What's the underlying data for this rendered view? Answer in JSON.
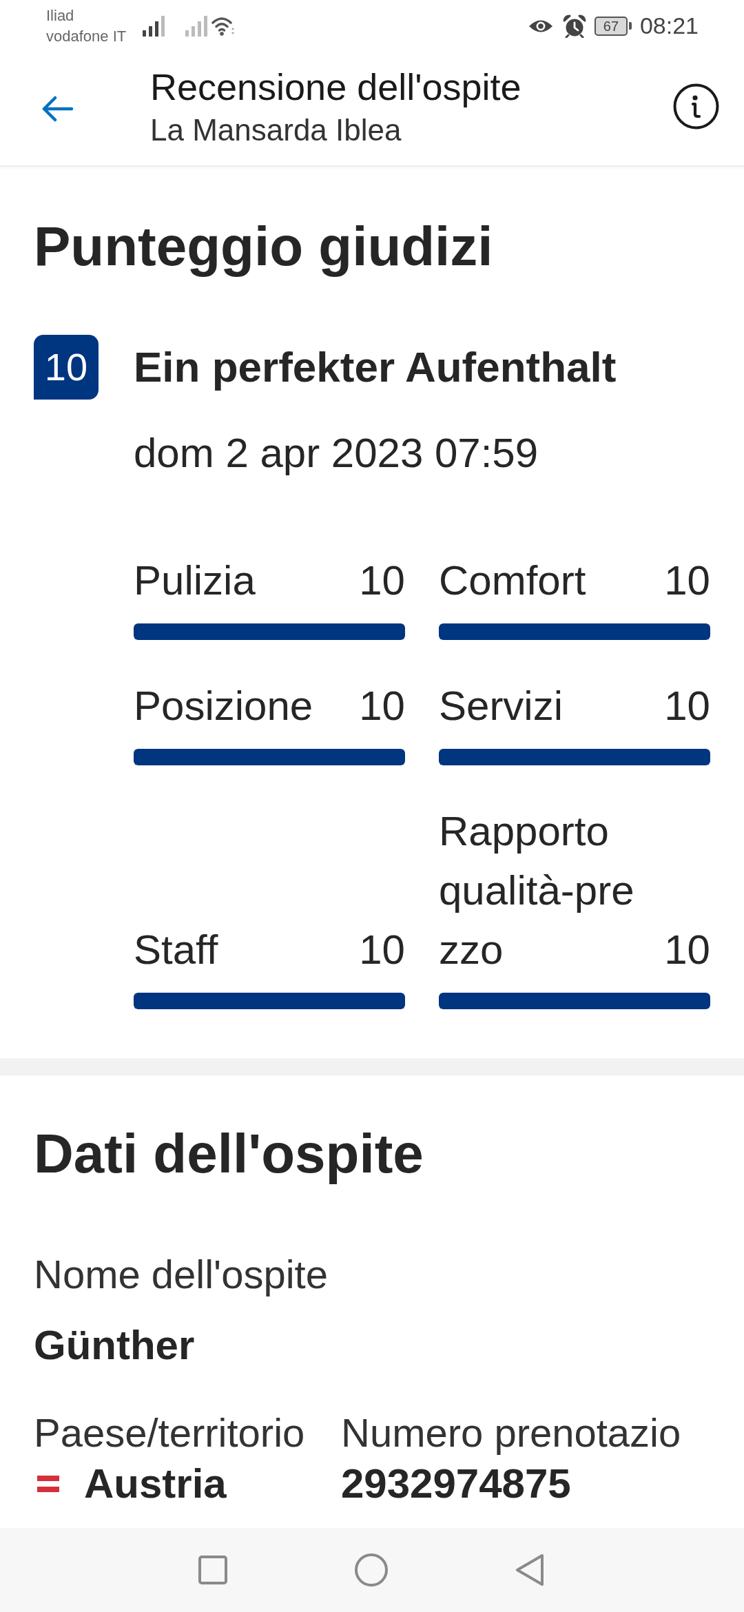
{
  "status_bar": {
    "carrier_lines": [
      "Iliad",
      "vodafone IT"
    ],
    "battery": "67",
    "time": "08:21"
  },
  "header": {
    "title": "Recensione dell'ospite",
    "subtitle": "La Mansarda Iblea"
  },
  "ratings": {
    "heading": "Punteggio giudizi",
    "review": {
      "score": "10",
      "title": "Ein perfekter Aufenthalt",
      "date": "dom 2 apr 2023 07:59"
    },
    "categories": [
      {
        "label": "Pulizia",
        "score": "10",
        "level": 1
      },
      {
        "label": "Posizione",
        "score": "10",
        "level": 1
      },
      {
        "label": "Staff",
        "score": "10",
        "level": 1
      },
      {
        "label": "Comfort",
        "score": "10",
        "level": 1
      },
      {
        "label": "Servizi",
        "score": "10",
        "level": 1
      },
      {
        "label": "Rapporto qualità-prezzo",
        "score": "10",
        "level": 1
      }
    ]
  },
  "guest": {
    "heading": "Dati dell'ospite",
    "name": {
      "label": "Nome dell'ospite",
      "value": "Günther"
    },
    "details": [
      {
        "kind": "country",
        "label": "Paese/territorio",
        "value": "Austria"
      },
      {
        "kind": "plain",
        "label": "Numero prenotazio",
        "value": "2932974875"
      }
    ]
  }
}
